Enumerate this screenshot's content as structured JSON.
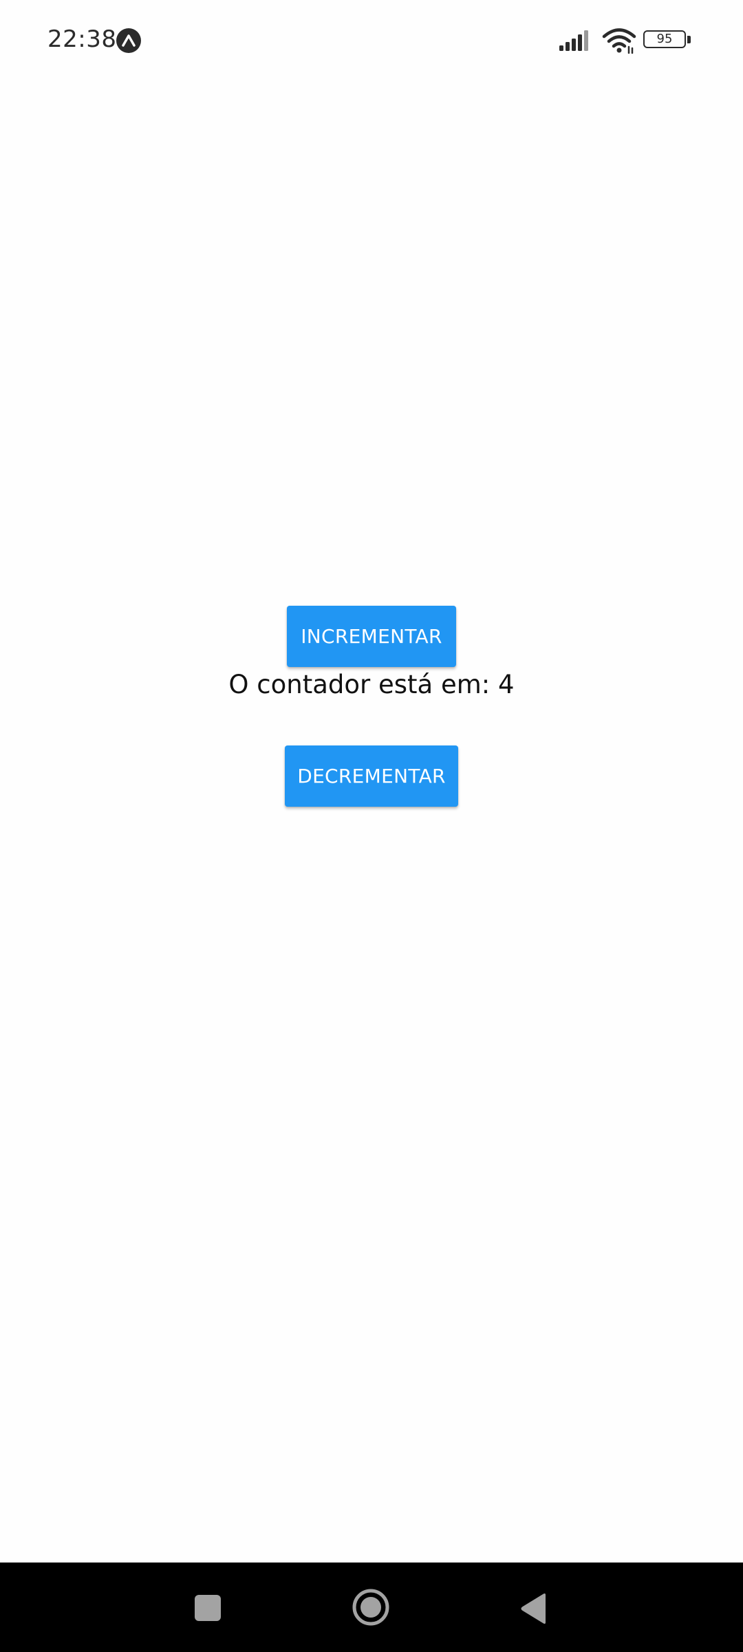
{
  "status_bar": {
    "time": "22:38",
    "app_indicator_icon": "expo-logo-icon",
    "signal_icon": "cellular-signal-icon",
    "wifi_icon": "wifi-icon",
    "battery_level": "95",
    "battery_icon": "battery-icon"
  },
  "main": {
    "increment_label": "INCREMENTAR",
    "counter_text": "O contador está em: 4",
    "decrement_label": "DECREMENTAR"
  },
  "navigation": {
    "recents_icon": "square-recents-icon",
    "home_icon": "circle-home-icon",
    "back_icon": "triangle-back-icon"
  },
  "colors": {
    "button_background": "#2196f3",
    "button_text": "#ffffff",
    "page_background": "#fefefe",
    "nav_bar_background": "#000000",
    "nav_icon": "#a3a3a3"
  }
}
